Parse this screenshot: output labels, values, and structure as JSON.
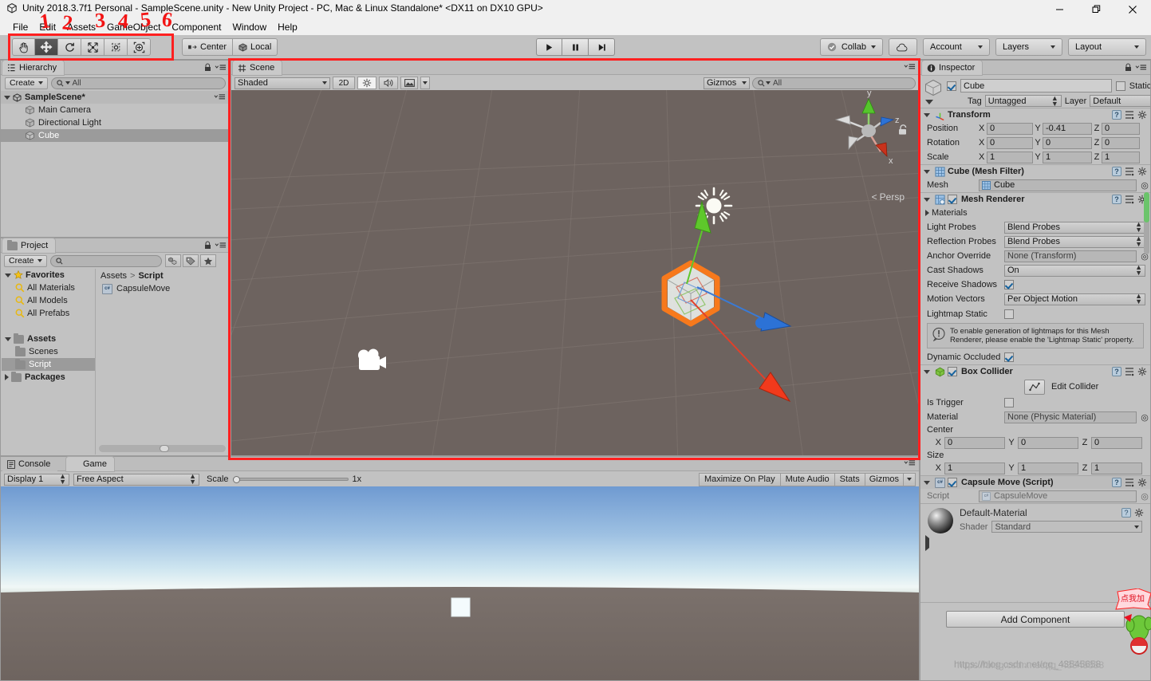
{
  "window": {
    "title": "Unity 2018.3.7f1 Personal - SampleScene.unity - New Unity Project - PC, Mac & Linux Standalone* <DX11 on DX10 GPU>",
    "minimize": "—",
    "restore": "❐",
    "close": "✕"
  },
  "menu": {
    "items": [
      "File",
      "Edit",
      "Assets",
      "GameObject",
      "Component",
      "Window",
      "Help"
    ]
  },
  "toolbar": {
    "tools": [
      {
        "name": "hand-tool",
        "label": "Hand",
        "active": false
      },
      {
        "name": "move-tool",
        "label": "Move",
        "active": true
      },
      {
        "name": "rotate-tool",
        "label": "Rotate",
        "active": false
      },
      {
        "name": "scale-tool",
        "label": "Scale",
        "active": false
      },
      {
        "name": "rect-tool",
        "label": "Rect",
        "active": false
      },
      {
        "name": "transform-tool",
        "label": "Transform",
        "active": false
      }
    ],
    "pivot_label": "Center",
    "space_label": "Local",
    "play_label": "Play",
    "pause_label": "Pause",
    "step_label": "Step",
    "collab_label": "Collab",
    "cloud_label": "Cloud",
    "account_label": "Account",
    "layers_label": "Layers",
    "layout_label": "Layout"
  },
  "annotations": {
    "numbers": [
      "1",
      "2",
      "3",
      "4",
      "5",
      "6"
    ],
    "badge_text": "点我加",
    "watermark": "https://blog.csdn.net/qq_43545658"
  },
  "hierarchy": {
    "tab": "Hierarchy",
    "create_label": "Create",
    "search_placeholder": "All",
    "scene_name": "SampleScene*",
    "items": [
      {
        "label": "Main Camera",
        "selected": false
      },
      {
        "label": "Directional Light",
        "selected": false
      },
      {
        "label": "Cube",
        "selected": true
      }
    ]
  },
  "project": {
    "tab": "Project",
    "create_label": "Create",
    "search_placeholder": "",
    "tree": [
      {
        "label": "Favorites",
        "type": "favorites",
        "depth": 0,
        "expanded": true
      },
      {
        "label": "All Materials",
        "type": "search",
        "depth": 1
      },
      {
        "label": "All Models",
        "type": "search",
        "depth": 1
      },
      {
        "label": "All Prefabs",
        "type": "search",
        "depth": 1
      },
      {
        "label": "",
        "type": "spacer",
        "depth": 0
      },
      {
        "label": "Assets",
        "type": "folder",
        "depth": 0,
        "expanded": true
      },
      {
        "label": "Scenes",
        "type": "folder",
        "depth": 1
      },
      {
        "label": "Script",
        "type": "folder",
        "depth": 1,
        "selected": true
      },
      {
        "label": "Packages",
        "type": "folder",
        "depth": 0,
        "expanded": false
      }
    ],
    "breadcrumb": [
      "Assets",
      "Script"
    ],
    "files": [
      {
        "label": "CapsuleMove",
        "type": "csharp"
      }
    ]
  },
  "scene": {
    "tab": "Scene",
    "shading_label": "Shaded",
    "mode_2d_label": "2D",
    "light_icon": "lighting-icon",
    "audio_icon": "audio-icon",
    "fx_icon": "effects-icon",
    "gizmos_label": "Gizmos",
    "search_placeholder": "All",
    "persp_label": "Persp",
    "axis_labels": {
      "x": "x",
      "y": "y",
      "z": "z"
    }
  },
  "game": {
    "console_tab": "Console",
    "game_tab": "Game",
    "display_label": "Display 1",
    "aspect_label": "Free Aspect",
    "scale_label": "Scale",
    "scale_value": "1x",
    "maximize_label": "Maximize On Play",
    "mute_label": "Mute Audio",
    "stats_label": "Stats",
    "gizmos_label": "Gizmos"
  },
  "inspector": {
    "tab": "Inspector",
    "object_name": "Cube",
    "object_enabled": true,
    "static_label": "Static",
    "tag_label": "Tag",
    "tag_value": "Untagged",
    "layer_label": "Layer",
    "layer_value": "Default",
    "transform": {
      "title": "Transform",
      "rows": [
        {
          "label": "Position",
          "x": "0",
          "y": "-0.41",
          "z": "0"
        },
        {
          "label": "Rotation",
          "x": "0",
          "y": "0",
          "z": "0"
        },
        {
          "label": "Scale",
          "x": "1",
          "y": "1",
          "z": "1"
        }
      ],
      "axis": [
        "X",
        "Y",
        "Z"
      ]
    },
    "mesh_filter": {
      "title": "Cube (Mesh Filter)",
      "mesh_label": "Mesh",
      "mesh_value": "Cube"
    },
    "mesh_renderer": {
      "title": "Mesh Renderer",
      "enabled": true,
      "materials_label": "Materials",
      "rows": [
        {
          "label": "Light Probes",
          "value": "Blend Probes",
          "kind": "dropdown"
        },
        {
          "label": "Reflection Probes",
          "value": "Blend Probes",
          "kind": "dropdown"
        },
        {
          "label": "Anchor Override",
          "value": "None (Transform)",
          "kind": "object"
        },
        {
          "label": "Cast Shadows",
          "value": "On",
          "kind": "dropdown"
        },
        {
          "label": "Receive Shadows",
          "value": "",
          "kind": "checkbox-on"
        },
        {
          "label": "Motion Vectors",
          "value": "Per Object Motion",
          "kind": "dropdown"
        }
      ],
      "lightmap_static_label": "Lightmap Static",
      "lightmap_static_checked": false,
      "help_text": "To enable generation of lightmaps for this Mesh Renderer, please enable the 'Lightmap Static' property.",
      "dynamic_occluded_label": "Dynamic Occluded",
      "dynamic_occluded_checked": true
    },
    "box_collider": {
      "title": "Box Collider",
      "enabled": true,
      "edit_collider_label": "Edit Collider",
      "is_trigger_label": "Is Trigger",
      "is_trigger_checked": false,
      "material_label": "Material",
      "material_value": "None (Physic Material)",
      "center_label": "Center",
      "center": {
        "x": "0",
        "y": "0",
        "z": "0"
      },
      "size_label": "Size",
      "size": {
        "x": "1",
        "y": "1",
        "z": "1"
      }
    },
    "script_component": {
      "title": "Capsule Move (Script)",
      "enabled": true,
      "script_label": "Script",
      "script_value": "CapsuleMove"
    },
    "material": {
      "title": "Default-Material",
      "shader_label": "Shader",
      "shader_value": "Standard"
    },
    "add_component_label": "Add Component"
  },
  "colors": {
    "accent_red": "#ff2020",
    "panel_bg": "#c2c2c2",
    "scene_bg": "#6d635f",
    "selection": "#9b9b9b",
    "gizmo_x": "#e1402a",
    "gizmo_y": "#5ec72b",
    "gizmo_z": "#2c72d6",
    "outline": "#ff7a18"
  }
}
